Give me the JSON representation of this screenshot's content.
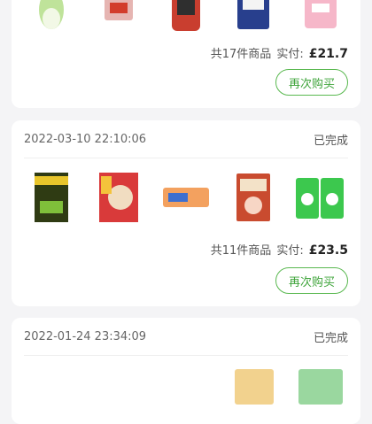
{
  "orders": [
    {
      "id": "order-1",
      "total_text": "共17件商品",
      "paid_label": "实付:",
      "paid_amount": "£21.7",
      "reorder_label": "再次购买",
      "products": [
        {
          "name": "cabbage",
          "color": "#bfe39a"
        },
        {
          "name": "soup-pack",
          "color": "#e6b5b2"
        },
        {
          "name": "sauce-jar",
          "color": "#c93e2f"
        },
        {
          "name": "noodle-box",
          "color": "#283f8d"
        },
        {
          "name": "pink-bag",
          "color": "#f6b7c9"
        }
      ]
    },
    {
      "id": "order-2",
      "datetime": "2022-03-10 22:10:06",
      "status": "已完成",
      "total_text": "共11件商品",
      "paid_label": "实付:",
      "paid_amount": "£23.5",
      "reorder_label": "再次购买",
      "products": [
        {
          "name": "pickle-pack",
          "color": "#2f3b13"
        },
        {
          "name": "dumpling-bag",
          "color": "#d93a3a"
        },
        {
          "name": "snack-box",
          "color": "#f3a15f"
        },
        {
          "name": "hotpot-sauce",
          "color": "#c94b2f"
        },
        {
          "name": "green-snack",
          "color": "#3cc84e"
        }
      ]
    },
    {
      "id": "order-3",
      "datetime": "2022-01-24 23:34:09",
      "status": "已完成",
      "products": [
        {
          "name": "partial-item",
          "color": "#f2d28e"
        },
        {
          "name": "partial-item-2",
          "color": "#9ad79f"
        }
      ]
    }
  ]
}
